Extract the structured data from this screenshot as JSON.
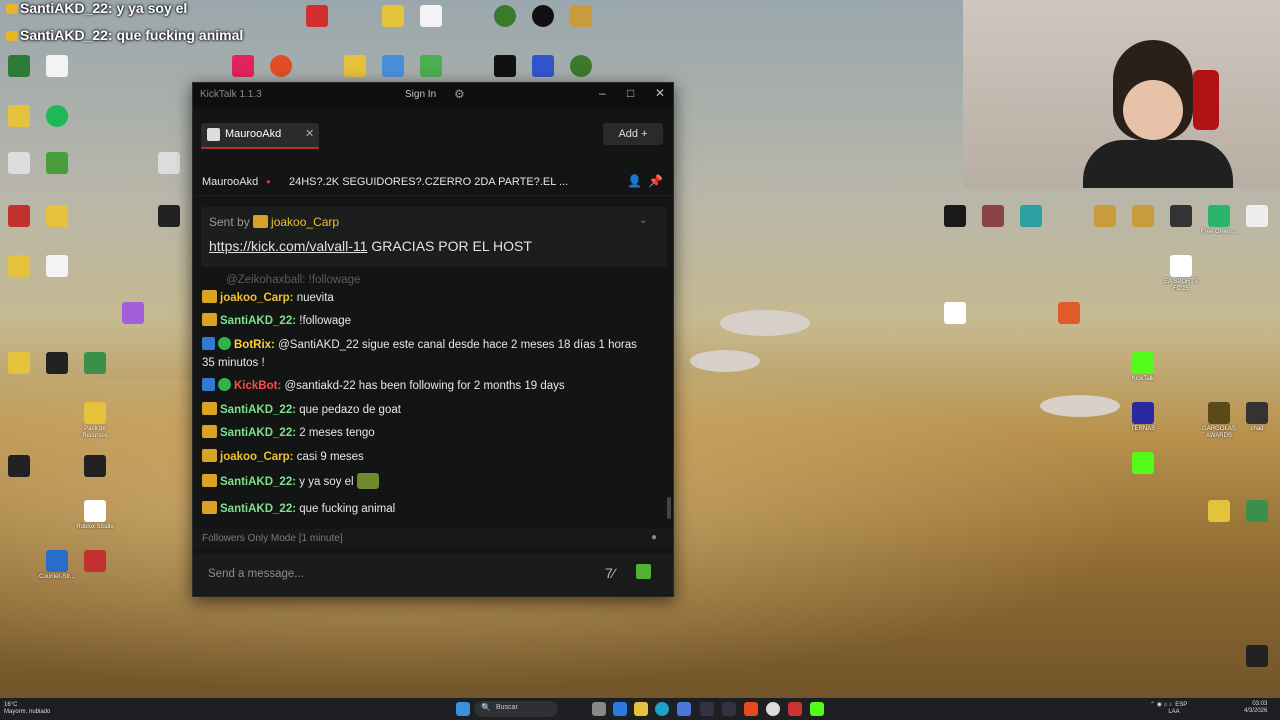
{
  "stream_overlay": {
    "lines": [
      "SantiAKD_22: y ya soy el",
      "SantiAKD_22: que fucking animal"
    ]
  },
  "window": {
    "title": "KickTalk 1.1.3",
    "sign_in": "Sign In",
    "tab": {
      "name": "MaurooAkd"
    },
    "add_label": "Add +",
    "channel": {
      "name": "MaurooAkd",
      "stream_title": "24HS?.2K SEGUIDORES?.CZERRO 2DA PARTE?.EL ..."
    },
    "pinned": {
      "sent_by_prefix": "Sent by",
      "sent_by_user": "joakoo_Carp",
      "link": "https://kick.com/valvall-11",
      "text": "GRACIAS POR EL HOST"
    },
    "messages": [
      {
        "user": "@Zeikohaxball:",
        "text": "!followage",
        "color": "#8a8a8a",
        "badge": "none"
      },
      {
        "user": "joakoo_Carp:",
        "text": "nuevita",
        "color": "#f2c230",
        "badge": "crown"
      },
      {
        "user": "SantiAKD_22:",
        "text": "!followage",
        "color": "#7ee08a",
        "badge": "crown"
      },
      {
        "user": "BotRix:",
        "text": "@SantiAKD_22 sigue este canal desde hace 2 meses 18 días 1 horas 35 minutos !",
        "color": "#ffd23c",
        "badge": "bot"
      },
      {
        "user": "KickBot:",
        "text": "@santiakd-22 has been following for 2 months 19 days",
        "color": "#ff4a4a",
        "badge": "bot"
      },
      {
        "user": "SantiAKD_22:",
        "text": "que pedazo de goat",
        "color": "#7ee08a",
        "badge": "crown"
      },
      {
        "user": "SantiAKD_22:",
        "text": "2 meses tengo",
        "color": "#7ee08a",
        "badge": "crown"
      },
      {
        "user": "joakoo_Carp:",
        "text": "casi 9 meses",
        "color": "#f2c230",
        "badge": "crown"
      },
      {
        "user": "SantiAKD_22:",
        "text": "y ya soy el",
        "color": "#7ee08a",
        "badge": "crown"
      },
      {
        "user": "SantiAKD_22:",
        "text": "que fucking animal",
        "color": "#7ee08a",
        "badge": "crown"
      }
    ],
    "followers_only": "Followers Only Mode [1 minute]",
    "input_placeholder": "Send a message..."
  },
  "taskbar": {
    "weather_temp": "16°C",
    "weather_desc": "Mayorm. nublado",
    "search_placeholder": "Buscar",
    "lang": "ESP",
    "lang2": "LAA",
    "time": "03:03",
    "date": "4/3/2026"
  },
  "desktop_icons": [
    "Counter-Str...",
    "Pack de Recursos",
    "Roblox Studio",
    "CAPCUT",
    "EA SPORTS FC 25",
    "GARGOLAS AWARDS",
    "Free Green...",
    "TERNAS",
    "KickTalk",
    "chad"
  ]
}
